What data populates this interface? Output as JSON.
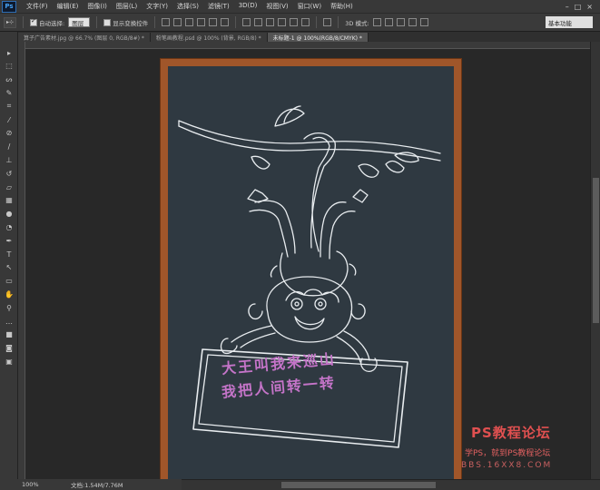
{
  "app": {
    "logo": "Ps",
    "menu": [
      "文件(F)",
      "编辑(E)",
      "图像(I)",
      "图层(L)",
      "文字(Y)",
      "选择(S)",
      "滤镜(T)",
      "3D(D)",
      "视图(V)",
      "窗口(W)",
      "帮助(H)"
    ],
    "window_controls": [
      "–",
      "□",
      "×"
    ]
  },
  "options": {
    "auto_select_label": "自动选择:",
    "auto_select_value": "图层",
    "show_transform_label": "显示变换控件",
    "mode_3d_label": "3D 模式:",
    "workspace": "基本功能"
  },
  "tabs": [
    {
      "label": "算子广告素材.jpg @ 66.7% (图层 0, RGB/8#) *",
      "active": false
    },
    {
      "label": "粉笔画教程.psd @ 100% (背景, RGB/8) *",
      "active": false
    },
    {
      "label": "未标题-1 @ 100%(RGB/8/CMYK) *",
      "active": true
    }
  ],
  "tools": [
    {
      "icon": "move-tool-icon",
      "glyph": "▸"
    },
    {
      "icon": "marquee-tool-icon",
      "glyph": "⬚"
    },
    {
      "icon": "lasso-tool-icon",
      "glyph": "ᔕ"
    },
    {
      "icon": "quick-select-tool-icon",
      "glyph": "✎"
    },
    {
      "icon": "crop-tool-icon",
      "glyph": "⌗"
    },
    {
      "icon": "eyedropper-tool-icon",
      "glyph": "⁄"
    },
    {
      "icon": "healing-brush-tool-icon",
      "glyph": "⊘"
    },
    {
      "icon": "brush-tool-icon",
      "glyph": "∕"
    },
    {
      "icon": "clone-stamp-tool-icon",
      "glyph": "⊥"
    },
    {
      "icon": "history-brush-tool-icon",
      "glyph": "↺"
    },
    {
      "icon": "eraser-tool-icon",
      "glyph": "▱"
    },
    {
      "icon": "gradient-tool-icon",
      "glyph": "▦"
    },
    {
      "icon": "blur-tool-icon",
      "glyph": "●"
    },
    {
      "icon": "dodge-tool-icon",
      "glyph": "◔"
    },
    {
      "icon": "pen-tool-icon",
      "glyph": "✒"
    },
    {
      "icon": "type-tool-icon",
      "glyph": "T"
    },
    {
      "icon": "path-select-tool-icon",
      "glyph": "↖"
    },
    {
      "icon": "shape-tool-icon",
      "glyph": "▭"
    },
    {
      "icon": "hand-tool-icon",
      "glyph": "✋"
    },
    {
      "icon": "zoom-tool-icon",
      "glyph": "⚲"
    },
    {
      "icon": "more-tools-icon",
      "glyph": "…"
    },
    {
      "icon": "color-swatches-icon",
      "glyph": "■"
    },
    {
      "icon": "quick-mask-icon",
      "glyph": "◙"
    },
    {
      "icon": "screen-mode-icon",
      "glyph": "▣"
    }
  ],
  "sign": {
    "line1": "大王叫我来巡山",
    "line2": "我把人间转一转"
  },
  "watermark": {
    "line1": "PS教程论坛",
    "line2": "学PS，就到PS教程论坛",
    "line3": "BBS.16XX8.COM"
  },
  "status": {
    "zoom": "100%",
    "doc": "文档:1.54M/7.76M"
  },
  "colors": {
    "chalkboard": "#2f3941",
    "frame": "#a0562a",
    "sign_text": "#c474c8",
    "watermark": "#e05050"
  }
}
